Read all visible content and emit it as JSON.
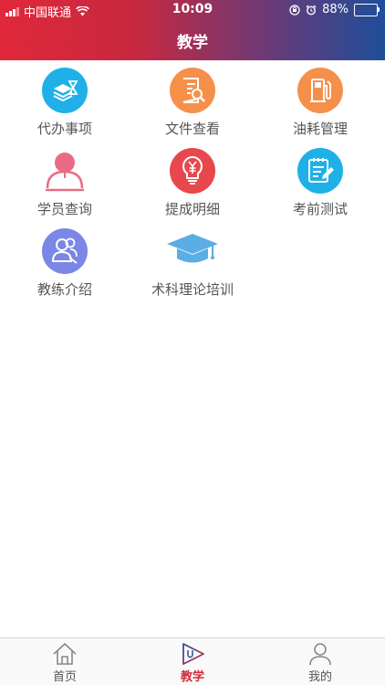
{
  "status_bar": {
    "carrier": "中国联通",
    "time": "10:09",
    "battery_percent": "88%"
  },
  "header": {
    "title": "教学"
  },
  "menu_items": [
    {
      "label": "代办事项",
      "icon": "hourglass-stack-icon",
      "color": "#1fb0e8"
    },
    {
      "label": "文件查看",
      "icon": "document-search-icon",
      "color": "#f5904b"
    },
    {
      "label": "油耗管理",
      "icon": "fuel-pump-icon",
      "color": "#f5904b"
    },
    {
      "label": "学员查询",
      "icon": "student-icon",
      "color": "#e96b86"
    },
    {
      "label": "提成明细",
      "icon": "yen-lightbulb-icon",
      "color": "#e8474e"
    },
    {
      "label": "考前测试",
      "icon": "clipboard-edit-icon",
      "color": "#1fb0e8"
    },
    {
      "label": "教练介绍",
      "icon": "coach-group-icon",
      "color": "#7b86e6"
    },
    {
      "label": "术科理论培训",
      "icon": "graduation-cap-icon",
      "color": "#5aaee4"
    }
  ],
  "tabbar": {
    "tabs": [
      {
        "label": "首页",
        "icon": "home-icon"
      },
      {
        "label": "教学",
        "icon": "play-icon",
        "active": true
      },
      {
        "label": "我的",
        "icon": "user-icon"
      }
    ]
  },
  "colors": {
    "active_tab": "#d02b3c",
    "label_text": "#555555"
  }
}
